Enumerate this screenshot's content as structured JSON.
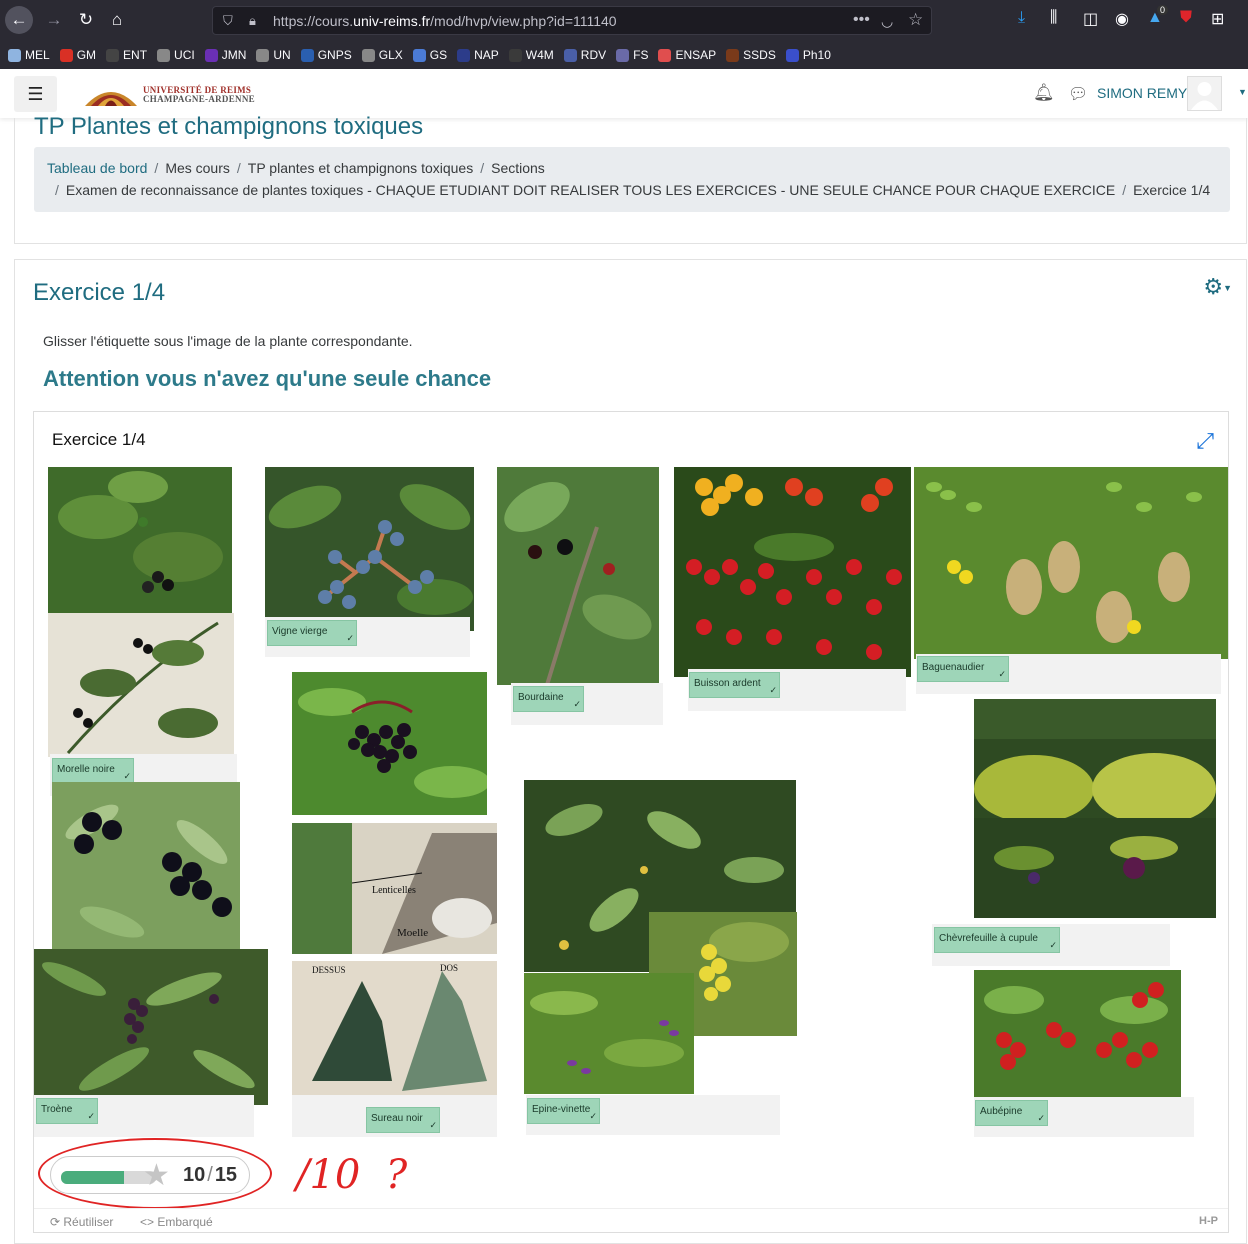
{
  "browser": {
    "url_prefix": "https://cours.",
    "url_domain": "univ-reims.fr",
    "url_path": "/mod/hvp/view.php?id=111140",
    "downloads_badge": "0",
    "bookmarks": [
      {
        "label": "MEL",
        "color": "#8fb4e0"
      },
      {
        "label": "GM",
        "color": "#d93025"
      },
      {
        "label": "ENT",
        "color": "#444444"
      },
      {
        "label": "UCI",
        "color": "#888888"
      },
      {
        "label": "JMN",
        "color": "#6a2fb5"
      },
      {
        "label": "UN",
        "color": "#888888"
      },
      {
        "label": "GNPS",
        "color": "#2a5fb0"
      },
      {
        "label": "GLX",
        "color": "#888888"
      },
      {
        "label": "GS",
        "color": "#4b7bd6"
      },
      {
        "label": "NAP",
        "color": "#2c3c8a"
      },
      {
        "label": "W4M",
        "color": "#3a3a3a"
      },
      {
        "label": "RDV",
        "color": "#4a5fa8"
      },
      {
        "label": "FS",
        "color": "#6a6aa8"
      },
      {
        "label": "ENSAP",
        "color": "#e04e4e"
      },
      {
        "label": "SSDS",
        "color": "#7a3a1a"
      },
      {
        "label": "Ph10",
        "color": "#3a4fcc"
      }
    ]
  },
  "header": {
    "logo_line1": "UNIVERSITÉ DE REIMS",
    "logo_line2": "CHAMPAGNE-ARDENNE",
    "user_name": "SIMON REMY"
  },
  "page": {
    "title": "TP Plantes et champignons toxiques",
    "breadcrumb": [
      "Tableau de bord",
      "Mes cours",
      "TP plantes et champignons toxiques",
      "Sections",
      "Examen de reconnaissance de plantes toxiques - CHAQUE ETUDIANT DOIT REALISER TOUS LES EXERCICES - UNE SEULE CHANCE POUR CHAQUE EXERCICE",
      "Exercice 1/4"
    ]
  },
  "activity": {
    "title": "Exercice 1/4",
    "instructions": "Glisser l'étiquette sous l'image de la plante correspondante.",
    "warning": "Attention vous n'avez qu'une seule chance",
    "h5p_title": "Exercice 1/4",
    "labels": {
      "vigne": "Vigne vierge",
      "bourdaine": "Bourdaine",
      "buisson": "Buisson ardent",
      "baguenaudier": "Baguenaudier",
      "morelle": "Morelle noire",
      "chevrefeuille": "Chèvrefeuille à cupule",
      "troene": "Troène",
      "sureau": "Sureau noir",
      "epine": "Epine-vinette",
      "aubepine": "Aubépine"
    },
    "image_text": {
      "lenticelles": "Lenticelles",
      "moelle": "Moelle",
      "dessus": "DESSUS",
      "dos": "DOS"
    },
    "score": {
      "value": 10,
      "max": 15,
      "separator": "/",
      "fraction": 0.667
    },
    "annotation": "/10  ?",
    "footer": {
      "reuse": "Réutiliser",
      "embed": "Embarqué",
      "brand": "H-P"
    }
  },
  "colors": {
    "accent": "#1f6c80",
    "label_bg": "#9ed5b8",
    "score_fill": "#4aac7c",
    "annotation_red": "#e02424"
  }
}
